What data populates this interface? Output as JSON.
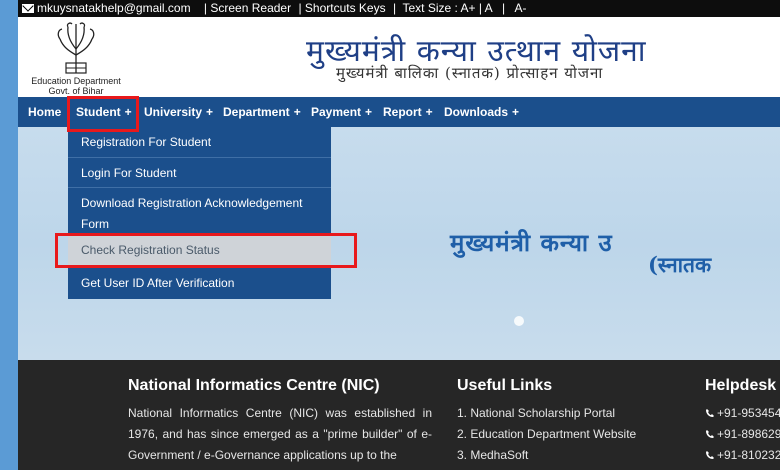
{
  "topbar": {
    "email": "mkuysnatakhelp@gmail.com",
    "screen_reader": "| Screen Reader",
    "shortcuts": "| Shortcuts Keys",
    "text_size": "|  Text Size : A+ | A   |   A-"
  },
  "header": {
    "logo_line1": "Education Department",
    "logo_line2": "Govt. of Bihar",
    "title": "मुख्यमंत्री कन्या उत्थान योजना",
    "subtitle": "मुख्यमंत्री बालिका (स्नातक) प्रोत्साहन योजना"
  },
  "nav": {
    "items": [
      {
        "label": "Home",
        "plus": ""
      },
      {
        "label": "Student",
        "plus": "+"
      },
      {
        "label": "University",
        "plus": "+"
      },
      {
        "label": "Department",
        "plus": "+"
      },
      {
        "label": "Payment",
        "plus": "+"
      },
      {
        "label": "Report",
        "plus": "+"
      },
      {
        "label": "Downloads",
        "plus": "+"
      }
    ]
  },
  "dropdown": {
    "items": [
      "Registration For Student",
      "Login For Student",
      "Download Registration Acknowledgement Form",
      "Check Registration Status",
      "Get User ID After Verification"
    ]
  },
  "hero": {
    "line1": "मुख्यमंत्री कन्या उ",
    "line2": "(स्नातक"
  },
  "footer": {
    "nic_title": "National Informatics Centre (NIC)",
    "nic_text": "National Informatics Centre (NIC) was established in 1976, and has since emerged as a \"prime builder\" of e-Government / e-Governance applications up to the",
    "links_title": "Useful Links",
    "links": [
      "1. National Scholarship Portal",
      "2. Education Department Website",
      "3. MedhaSoft"
    ],
    "helpdesk_title": "Helpdesk",
    "phones": [
      "+91-953454",
      "+91-898629",
      "+91-810232"
    ]
  },
  "colors": {
    "nav_bg": "#1b4f8c",
    "highlight": "#e8191c",
    "footer_bg": "#262626"
  }
}
